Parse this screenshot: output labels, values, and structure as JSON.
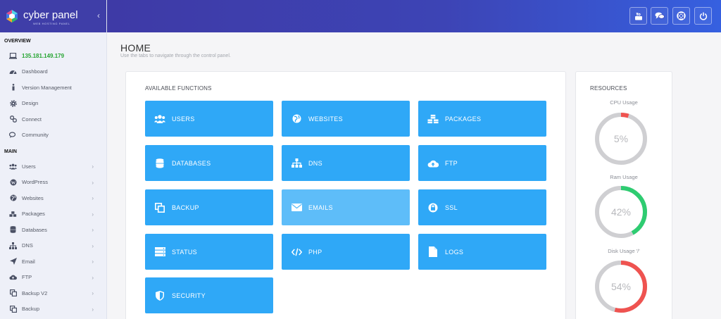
{
  "brand": {
    "name": "cyber panel",
    "tagline": "WEB HOSTING PANEL",
    "collapse_glyph": "‹"
  },
  "sidebar": {
    "overview_title": "OVERVIEW",
    "overview_items": [
      {
        "label": "135.181.149.179",
        "icon": "laptop-icon"
      },
      {
        "label": "Dashboard",
        "icon": "dashboard-icon"
      },
      {
        "label": "Version Management",
        "icon": "info-icon"
      },
      {
        "label": "Design",
        "icon": "gear-icon"
      },
      {
        "label": "Connect",
        "icon": "link-icon"
      },
      {
        "label": "Community",
        "icon": "comments-icon"
      }
    ],
    "main_title": "MAIN",
    "main_items": [
      {
        "label": "Users",
        "icon": "users-icon"
      },
      {
        "label": "WordPress",
        "icon": "wordpress-icon"
      },
      {
        "label": "Websites",
        "icon": "globe-icon"
      },
      {
        "label": "Packages",
        "icon": "cubes-icon"
      },
      {
        "label": "Databases",
        "icon": "database-icon"
      },
      {
        "label": "DNS",
        "icon": "sitemap-icon"
      },
      {
        "label": "Email",
        "icon": "paper-plane-icon"
      },
      {
        "label": "FTP",
        "icon": "cloud-upload-icon"
      },
      {
        "label": "Backup V2",
        "icon": "copy-icon"
      },
      {
        "label": "Backup",
        "icon": "copy-icon"
      }
    ],
    "chevron": "›"
  },
  "header": {
    "buttons": [
      {
        "name": "youtube-icon"
      },
      {
        "name": "chat-icon"
      },
      {
        "name": "support-icon"
      },
      {
        "name": "power-icon"
      }
    ]
  },
  "page": {
    "title": "HOME",
    "subtitle": "Use the tabs to navigate through the control panel."
  },
  "functions": {
    "title": "AVAILABLE FUNCTIONS",
    "tiles": [
      {
        "label": "USERS",
        "icon": "users-icon"
      },
      {
        "label": "WEBSITES",
        "icon": "globe-icon"
      },
      {
        "label": "PACKAGES",
        "icon": "cubes-icon"
      },
      {
        "label": "DATABASES",
        "icon": "database-icon"
      },
      {
        "label": "DNS",
        "icon": "sitemap-icon"
      },
      {
        "label": "FTP",
        "icon": "cloud-upload-icon"
      },
      {
        "label": "BACKUP",
        "icon": "copy-icon"
      },
      {
        "label": "EMAILS",
        "icon": "envelope-icon"
      },
      {
        "label": "SSL",
        "icon": "lock-icon"
      },
      {
        "label": "STATUS",
        "icon": "server-icon"
      },
      {
        "label": "PHP",
        "icon": "code-icon"
      },
      {
        "label": "LOGS",
        "icon": "file-icon"
      },
      {
        "label": "SECURITY",
        "icon": "shield-icon"
      }
    ]
  },
  "resources": {
    "title": "RESOURCES",
    "gauges": [
      {
        "label": "CPU Usage",
        "value": "5%",
        "percent": 5,
        "color": "#ef5350"
      },
      {
        "label": "Ram Usage",
        "value": "42%",
        "percent": 42,
        "color": "#2ecc71"
      },
      {
        "label": "Disk Usage '/'",
        "value": "54%",
        "percent": 54,
        "color": "#ef5350"
      }
    ]
  },
  "colors": {
    "tile": "#2fa8f7",
    "tile_hover": "#5ebdf9",
    "header_start": "#3e3aa6",
    "header_end": "#3660e0",
    "ip_green": "#27a533"
  }
}
